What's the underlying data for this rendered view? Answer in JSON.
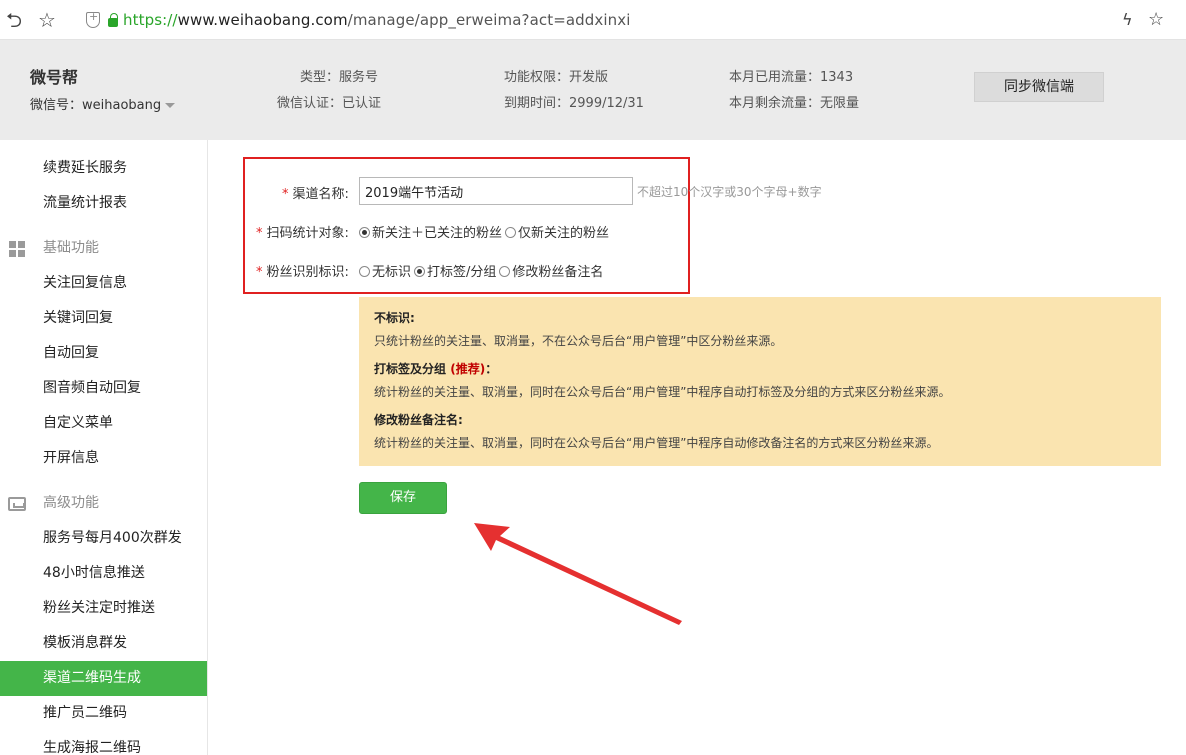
{
  "browser": {
    "url_scheme": "https://",
    "url_host": "www.weihaobang.com",
    "url_path": "/manage/app_erweima?act=addxinxi"
  },
  "header": {
    "brand": "微号帮",
    "account": "微信号：weihaobang",
    "type": "类型：服务号",
    "verify": "微信认证：已认证",
    "permission": "功能权限：开发版",
    "expire": "到期时间：2999/12/31",
    "used_flow": "本月已用流量：1343",
    "remain_flow": "本月剩余流量：无限量",
    "sync_label": "同步微信端"
  },
  "sidebar": {
    "top_items": [
      "续费延长服务",
      "流量统计报表"
    ],
    "group_basic": "基础功能",
    "basic_items": [
      "关注回复信息",
      "关键词回复",
      "自动回复",
      "图音频自动回复",
      "自定义菜单",
      "开屏信息"
    ],
    "group_advanced": "高级功能",
    "advanced_items": [
      "服务号每月400次群发",
      "48小时信息推送",
      "粉丝关注定时推送",
      "模板消息群发",
      "渠道二维码生成",
      "推广员二维码",
      "生成海报二维码"
    ]
  },
  "form": {
    "req_mark": "*",
    "channel_label": "渠道名称:",
    "channel_value": "2019端午节活动",
    "channel_hint": "不超过10个汉字或30个字母+数字",
    "scan_label": "扫码统计对象:",
    "scan_opt1": "新关注＋已关注的粉丝",
    "scan_opt2": "仅新关注的粉丝",
    "fans_label": "粉丝识别标识:",
    "fans_opt1": "无标识",
    "fans_opt2": "打标签/分组",
    "fans_opt3": "修改粉丝备注名"
  },
  "note": {
    "t1": "不标识:",
    "d1": "只统计粉丝的关注量、取消量，不在公众号后台“用户管理”中区分粉丝来源。",
    "t2a": "打标签及分组",
    "t2b": "(推荐)",
    "t2c": "：",
    "d2": "统计粉丝的关注量、取消量，同时在公众号后台“用户管理”中程序自动打标签及分组的方式来区分粉丝来源。",
    "t3": "修改粉丝备注名:",
    "d3": "统计粉丝的关注量、取消量，同时在公众号后台“用户管理”中程序自动修改备注名的方式来区分粉丝来源。"
  },
  "save_label": "保存",
  "colors": {
    "accent": "#44b549",
    "annotation": "#e02020",
    "note_bg": "#fae4b0"
  }
}
